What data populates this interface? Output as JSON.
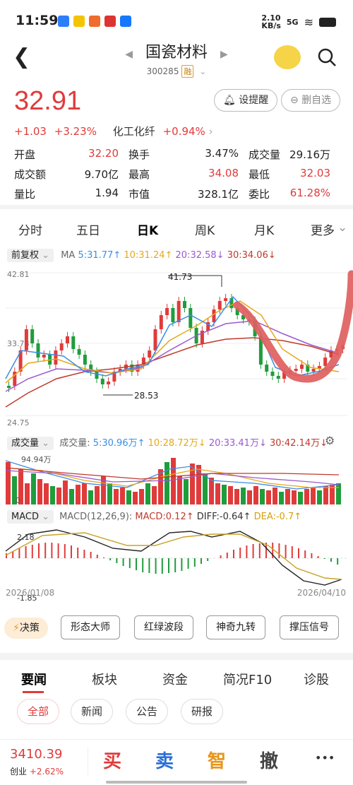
{
  "status": {
    "time": "11:59",
    "net_speed": "2.10",
    "net_unit": "KB/s",
    "signal": "5G",
    "battery": "■"
  },
  "header": {
    "title": "国瓷材料",
    "code": "300285",
    "badge": "融"
  },
  "quote": {
    "price": "32.91",
    "change": "+1.03",
    "pct": "+3.23%",
    "sector": "化工化纤",
    "sector_pct": "+0.94%",
    "alert_label": "设提醒",
    "remove_label": "删自选"
  },
  "stats": [
    [
      {
        "k": "开盘",
        "v": "32.20",
        "c": "red"
      },
      {
        "k": "换手",
        "v": "3.47%",
        "c": ""
      },
      {
        "k": "成交量",
        "v": "29.16万",
        "c": ""
      }
    ],
    [
      {
        "k": "成交额",
        "v": "9.70亿",
        "c": ""
      },
      {
        "k": "最高",
        "v": "34.08",
        "c": "red"
      },
      {
        "k": "最低",
        "v": "32.03",
        "c": "red"
      }
    ],
    [
      {
        "k": "量比",
        "v": "1.94",
        "c": ""
      },
      {
        "k": "市值",
        "v": "328.1亿",
        "c": ""
      },
      {
        "k": "委比",
        "v": "61.28%",
        "c": "red"
      }
    ]
  ],
  "tabs": [
    "分时",
    "五日",
    "日K",
    "周K",
    "月K",
    "更多"
  ],
  "active_tab": "日K",
  "kline": {
    "adj": "前复权",
    "ma_label": "MA",
    "ma5": "5:31.77↑",
    "ma10": "10:31.24↑",
    "ma20": "20:32.58↓",
    "ma30": "30:34.06↓",
    "ymax": "42.81",
    "ymid": "33.78",
    "ymin": "24.75",
    "hi_mark": "41.73",
    "lo_mark": "28.53"
  },
  "volume": {
    "label": "成交量",
    "prefix": "成交量:",
    "v5": "5:30.96万↑",
    "v10": "10:28.72万↓",
    "v20": "20:33.41万↓",
    "v30": "30:42.14万↓",
    "ymax": "94.94万",
    "ymin": "0"
  },
  "macd": {
    "label": "MACD",
    "params": "MACD(12,26,9):",
    "macd": "MACD:0.12↑",
    "diff": "DIFF:-0.64↑",
    "dea": "DEA:-0.7↑",
    "ymax": "2.18",
    "ymin": "-1.85",
    "date_start": "2026/01/08",
    "date_end": "2026/04/10"
  },
  "strategy": {
    "label": "决策",
    "buttons": [
      "形态大师",
      "红绿波段",
      "神奇九转",
      "撑压信号"
    ]
  },
  "news_tabs": [
    "要闻",
    "板块",
    "资金",
    "简况F10",
    "诊股"
  ],
  "news_chips": [
    "全部",
    "新闻",
    "公告",
    "研报"
  ],
  "bottom": {
    "index_value": "3410.39",
    "index_name": "创业",
    "index_pct": "+2.62%",
    "buy": "买",
    "sell": "卖",
    "smart": "智",
    "cancel": "撤",
    "more": "•••"
  },
  "colors": {
    "up": "#e03b3b",
    "down": "#1f9d3c",
    "ma5": "#3a8ee6",
    "ma10": "#e6a817",
    "ma20": "#9b59d0",
    "ma30": "#c0392b",
    "accent": "#e03b3b"
  }
}
